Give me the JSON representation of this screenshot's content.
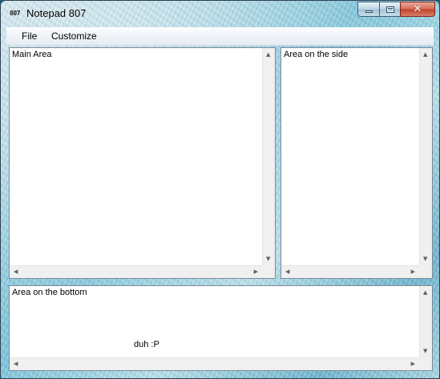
{
  "window": {
    "title": "Notepad 807",
    "icon_text": "807",
    "icon": "app-icon",
    "caption_icons": [
      "minimize-icon",
      "maximize-icon",
      "close-icon"
    ]
  },
  "menu": {
    "items": [
      {
        "label": "File"
      },
      {
        "label": "Customize"
      }
    ]
  },
  "panes": {
    "main": {
      "text": "Main Area"
    },
    "side": {
      "text": "Area on the side"
    },
    "bottom": {
      "text": "Area on the bottom",
      "extra_text": "duh :P"
    }
  },
  "colors": {
    "close_button": "#c1452c",
    "pane_background": "#ffffff",
    "scrollbar": "#f0f0f0"
  }
}
